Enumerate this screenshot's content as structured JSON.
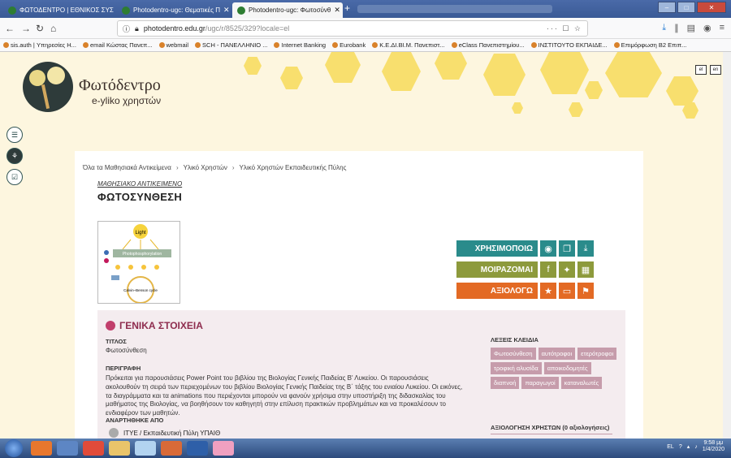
{
  "browser": {
    "tabs": [
      {
        "label": "ΦΩΤΟΔΕΝΤΡΟ | ΕΘΝΙΚΟΣ ΣΥΣ"
      },
      {
        "label": "Photodentro-ugc: Θεματικές Π"
      },
      {
        "label": "Photodentro-ugc: Φωτοσύνθ"
      }
    ],
    "url_domain": "photodentro.edu.gr",
    "url_path": "/ugc/r/8525/329?locale=el",
    "url_actions": "··· ☐ ☆",
    "bookmarks": [
      "sis.auth | Υπηρεσίες Η...",
      "email Κώστας Πανεπ...",
      "webmail",
      "SCH - ΠΑΝΕΛΛΗΝΙΟ ...",
      "Internet Banking",
      "Eurobank",
      "Κ.Ε.ΔΙ.ΒΙ.Μ. Πανεπιστ...",
      "eClass Πανεπιστημίου...",
      "ΙΝΣΤΙΤΟΥΤΟ ΕΚΠΑΙΔΕ...",
      "Επιμόρφωση Β2 Επιπ..."
    ]
  },
  "site": {
    "brand_title": "Φωτόδεντρο",
    "brand_subtitle": "e-yliko χρηστών",
    "lang_el": "el",
    "lang_en": "en"
  },
  "content": {
    "breadcrumb": [
      "Όλα τα Μαθησιακά Αντικείμενα",
      "Υλικό Χρηστών",
      "Υλικό Χρηστών Εκπαιδευτικής Πύλης"
    ],
    "kind": "ΜΑΘΗΣΙΑΚΟ ΑΝΤΙΚΕΙΜΕΝΟ",
    "title": "ΦΩΤΟΣΥΝΘΕΣΗ",
    "thumb": {
      "light": "Light",
      "process": "Photophosphorylation",
      "cycle": "Calvin–Benson cycle"
    },
    "actions": {
      "use": "ΧΡΗΣΙΜΟΠΟΙΩ",
      "share": "ΜΟΙΡΑΖΟΜΑΙ",
      "rate": "ΑΞΙΟΛΟΓΩ"
    },
    "section": {
      "title": "ΓΕΝΙΚΑ ΣΤΟΙΧΕΙΑ",
      "title_label": "ΤΙΤΛΟΣ",
      "title_value": "Φωτοσύνθεση",
      "desc_label": "ΠΕΡΙΓΡΑΦΗ",
      "desc_value": "Πρόκειται για παρουσιάσεις Power Point του βιβλίου της Βιολογίας Γενικής Παιδείας Β' Λυκείου. Οι παρουσιάσεις ακολουθούν τη σειρά των περιεχομένων του βιβλίου Βιολογίας Γενικής Παιδείας της Β΄ τάξης του ενιαίου Λυκείου. Οι εικόνες, τα διαγράμματα και τα animations που περιέχονται μπορούν να φανούν χρήσιμα στην υποστήριξη της διδασκαλίας του μαθήματος της Βιολογίας, να βοηθήσουν τον καθηγητή στην επίλυση πρακτικών προβλημάτων και να προκαλέσουν το ενδιαφέρον των μαθητών.",
      "posted_label": "ΑΝΑΡΤΗΘΗΚΕ ΑΠΟ",
      "posted_value": "ΙΤΥΕ / Εκπαιδευτική Πύλη ΥΠΑΙΘ",
      "keywords_label": "ΛΕΞΕΙΣ ΚΛΕΙΔΙΑ",
      "keywords": [
        "Φωτοσύνθεση",
        "αυτότροφοι",
        "ετερότροφοι",
        "τροφική αλυσίδα",
        "αποικοδομητές",
        "διαπνοή",
        "παραγωγοί",
        "καταναλωτές"
      ],
      "rating_label": "ΑΞΙΟΛΟΓΗΣΗ ΧΡΗΣΤΩΝ (0 αξιολογήσεις)"
    }
  },
  "taskbar": {
    "lang": "EL",
    "time": "9:58 μμ",
    "date": "1/4/2020"
  }
}
